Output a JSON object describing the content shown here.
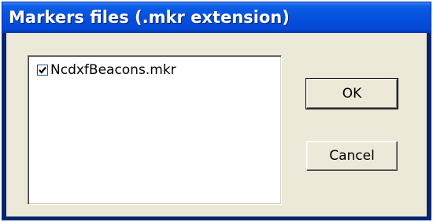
{
  "window": {
    "title": "Markers files (.mkr extension)"
  },
  "markers_list": {
    "items": [
      {
        "label": "NcdxfBeacons.mkr",
        "checked": true
      }
    ]
  },
  "buttons": {
    "ok_label": "OK",
    "cancel_label": "Cancel"
  },
  "icons": {
    "checkbox_check": "checkmark-icon"
  }
}
